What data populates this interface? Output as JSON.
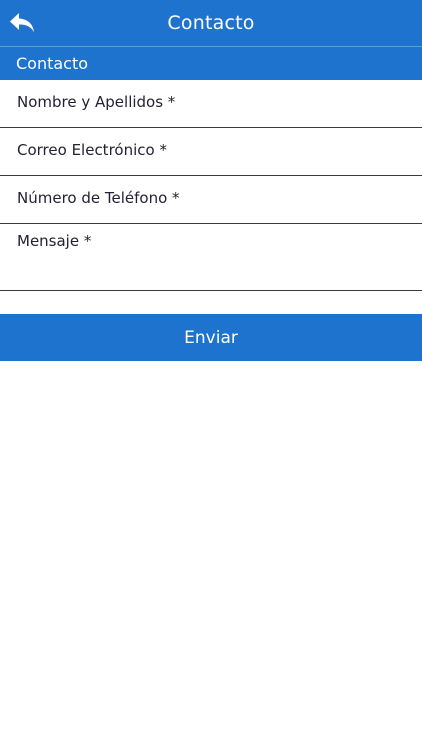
{
  "nav": {
    "title": "Contacto",
    "back_icon": "reply-arrow-icon"
  },
  "section": {
    "title": "Contacto"
  },
  "form": {
    "fields": [
      {
        "label": "Nombre y Apellidos *"
      },
      {
        "label": "Correo Electrónico *"
      },
      {
        "label": "Número de Teléfono *"
      },
      {
        "label": "Mensaje *"
      }
    ],
    "submit_label": "Enviar"
  },
  "colors": {
    "accent": "#1e73cf",
    "text": "#222233",
    "divider": "#3b3b3b",
    "background": "#ffffff"
  }
}
